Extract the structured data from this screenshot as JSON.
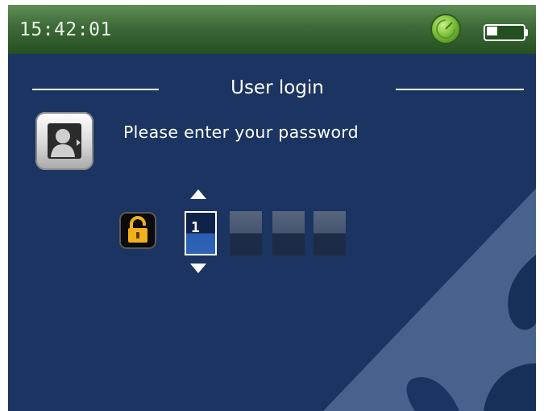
{
  "status_bar": {
    "time": "15:42:01",
    "indicator_icon": "status-ok-icon",
    "battery_icon": "battery-icon",
    "battery_level": 0.3
  },
  "login": {
    "title": "User login",
    "prompt": "Please enter your password",
    "user_icon": "user-icon",
    "lock_icon": "unlock-icon",
    "digits": [
      "1",
      "",
      "",
      ""
    ],
    "active_digit": 0
  },
  "colors": {
    "background": "#1b3461",
    "status_bar": "#3d6a38",
    "watermark": "#47628c",
    "lock_accent": "#f2b01e"
  }
}
